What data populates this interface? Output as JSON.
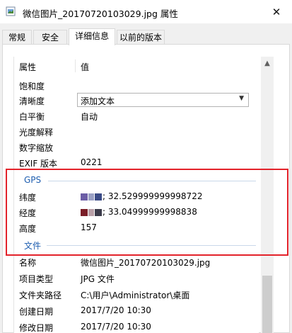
{
  "window": {
    "title": "微信图片_20170720103029.jpg 属性",
    "close_glyph": "✕"
  },
  "tabs": [
    {
      "label": "常规"
    },
    {
      "label": "安全"
    },
    {
      "label": "详细信息"
    },
    {
      "label": "以前的版本"
    }
  ],
  "columns": {
    "property": "属性",
    "value": "值"
  },
  "rows_top": [
    {
      "key": "饱和度",
      "value": ""
    },
    {
      "key": "清晰度",
      "value": "添加文本"
    },
    {
      "key": "白平衡",
      "value": "自动"
    },
    {
      "key": "光度解释",
      "value": ""
    },
    {
      "key": "数字缩放",
      "value": ""
    },
    {
      "key": "EXIF 版本",
      "value": "0221"
    }
  ],
  "groups": {
    "gps": "GPS",
    "file": "文件"
  },
  "gps_rows": [
    {
      "key": "纬度",
      "value": "; 32.529999999998722"
    },
    {
      "key": "经度",
      "value": "; 33.04999999998838"
    },
    {
      "key": "高度",
      "value": "157"
    }
  ],
  "file_rows": [
    {
      "key": "名称",
      "value": "微信图片_20170720103029.jpg"
    },
    {
      "key": "项目类型",
      "value": "JPG 文件"
    },
    {
      "key": "文件夹路径",
      "value": "C:\\用户\\Administrator\\桌面"
    },
    {
      "key": "创建日期",
      "value": "2017/7/20 10:30"
    },
    {
      "key": "修改日期",
      "value": "2017/7/20 10:30"
    }
  ],
  "colors": {
    "highlight": "#e3232b",
    "group_label": "#1e5eb0"
  }
}
